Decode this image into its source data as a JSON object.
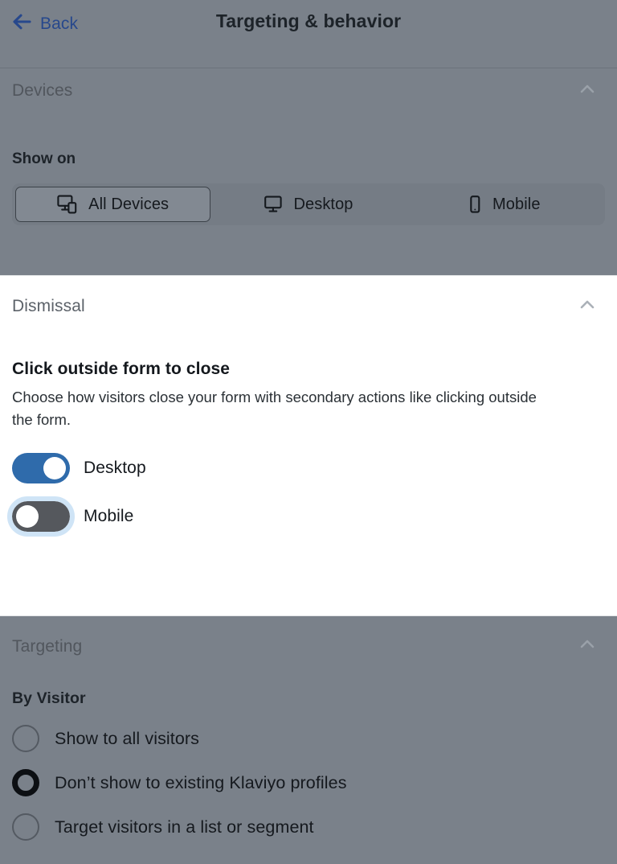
{
  "header": {
    "back_label": "Back",
    "back_icon": "arrow-left-icon",
    "title": "Targeting & behavior"
  },
  "colors": {
    "overlay_gray": "#7a818a",
    "panel_white": "#ffffff",
    "link_blue": "#27488c",
    "toggle_on_blue": "#2f6bab",
    "toggle_off_gray": "#55585d",
    "focus_ring_blue": "#cfe4f6",
    "radio_checked": "#0c0f13"
  },
  "sections": {
    "devices": {
      "title": "Devices",
      "collapse_icon": "chevron-up-icon",
      "field_label": "Show on",
      "segmented": {
        "selected": "All Devices",
        "options": [
          {
            "label": "All Devices",
            "icon": "all-devices-icon",
            "selected": true
          },
          {
            "label": "Desktop",
            "icon": "desktop-icon",
            "selected": false
          },
          {
            "label": "Mobile",
            "icon": "mobile-icon",
            "selected": false
          }
        ]
      }
    },
    "dismissal": {
      "title": "Dismissal",
      "collapse_icon": "chevron-up-icon",
      "sub_heading": "Click outside form to close",
      "sub_description": "Choose how visitors close your form with secondary actions like clicking outside the form.",
      "toggles": [
        {
          "label": "Desktop",
          "state": "on",
          "focused": false
        },
        {
          "label": "Mobile",
          "state": "off",
          "focused": true
        }
      ]
    },
    "targeting": {
      "title": "Targeting",
      "collapse_icon": "chevron-up-icon",
      "group_label": "By Visitor",
      "radios": [
        {
          "label": "Show to all visitors",
          "checked": false
        },
        {
          "label": "Don’t show to existing Klaviyo profiles",
          "checked": true
        },
        {
          "label": "Target visitors in a list or segment",
          "checked": false
        }
      ]
    }
  }
}
